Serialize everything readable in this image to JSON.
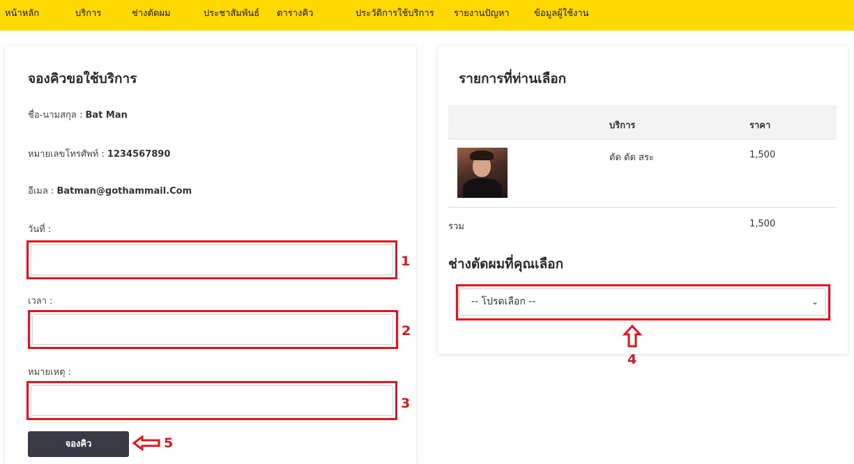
{
  "nav": {
    "items": [
      "หน้าหลัก",
      "บริการ",
      "ช่างตัดผม",
      "ประชาสัมพันธ์",
      "ตารางคิว",
      "ประวัติการใช้บริการ",
      "รายงานปัญหา",
      "ข้อมูลผู้ใช้งาน"
    ]
  },
  "booking": {
    "title": "จองคิวขอใช้บริการ",
    "name_label": "ชื่อ-นามสกุล : ",
    "name_value": "Bat Man",
    "phone_label": "หมายเลขโทรศัพท์ : ",
    "phone_value": "1234567890",
    "email_label": "อีเมล : ",
    "email_value": "Batman@gothammail.Com",
    "date_label": "วันที่ :",
    "time_label": "เวลา :",
    "note_label": "หมายเหตุ :",
    "submit_label": "จองคิว"
  },
  "selection": {
    "title": "รายการที่ท่านเลือก",
    "col_service": "บริการ",
    "col_price": "ราคา",
    "row_service": "ตัด ตัด สระ",
    "row_price": "1,500",
    "total_label": "รวม",
    "total_price": "1,500"
  },
  "barber": {
    "title": "ช่างตัดผมที่คุณเลือก",
    "select_value": "-- โปรดเลือก --"
  },
  "annotations": [
    "1",
    "2",
    "3",
    "4",
    "5"
  ],
  "colors": {
    "nav_bg": "#ffd900",
    "annotation_red": "#e0141e",
    "button_bg": "#383b45"
  }
}
